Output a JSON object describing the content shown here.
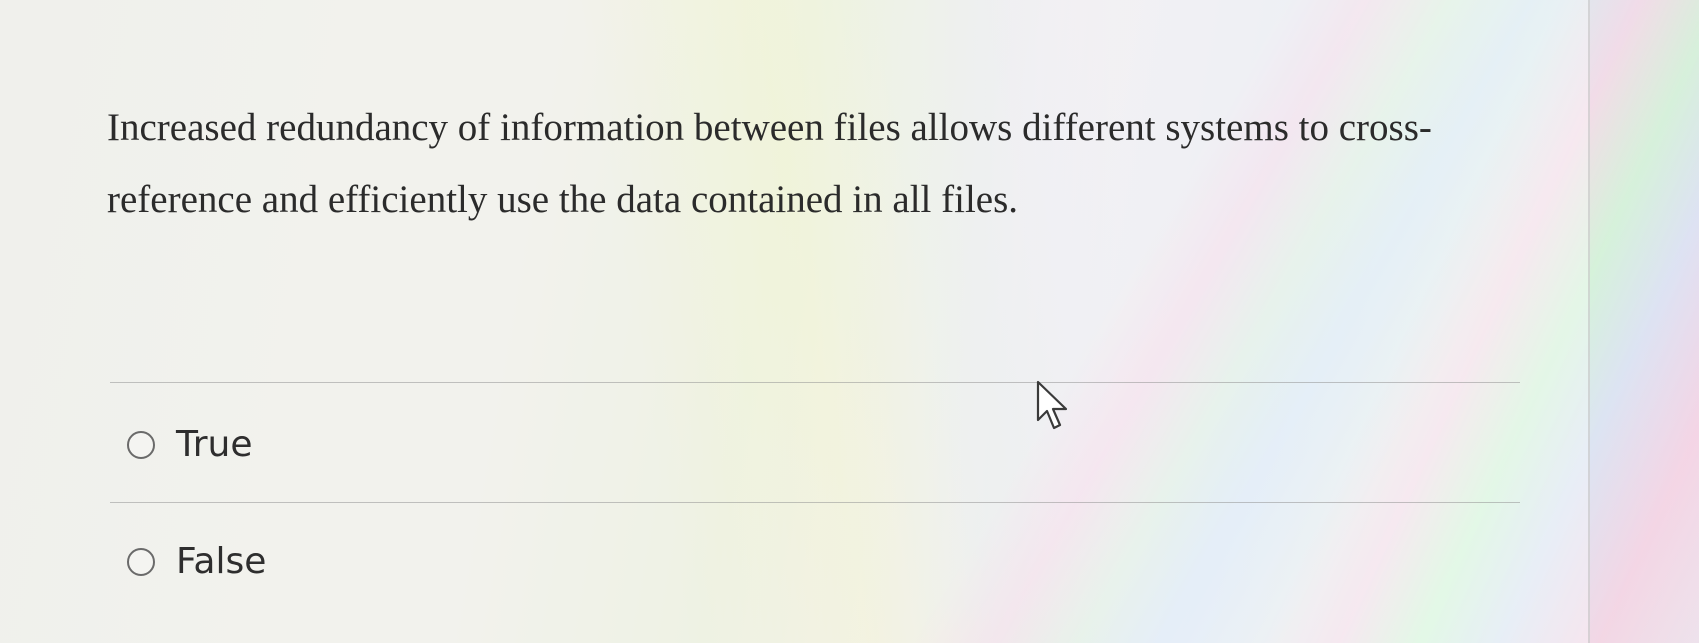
{
  "question": {
    "text": "Increased redundancy of information between files allows different systems to cross-reference and efficiently use the data contained in all files."
  },
  "options": [
    {
      "label": "True",
      "selected": false
    },
    {
      "label": "False",
      "selected": false
    }
  ],
  "cursor": {
    "icon": "arrow-cursor-icon"
  }
}
